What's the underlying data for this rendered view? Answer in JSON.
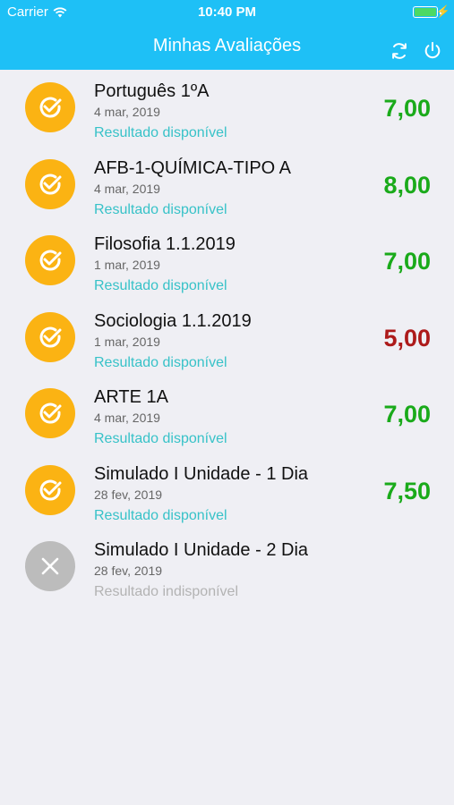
{
  "status_bar": {
    "carrier": "Carrier",
    "time": "10:40 PM",
    "battery_level": 1.0
  },
  "header": {
    "title": "Minhas Avaliações",
    "actions": [
      "refresh-icon",
      "power-icon"
    ]
  },
  "colors": {
    "primary": "#1ec0f6",
    "icon_available": "#fbb313",
    "icon_unavailable": "#bcbcbc",
    "grade_pass": "#1aaa1a",
    "grade_fail": "#ad1a1a",
    "status_available": "#37c2c8",
    "status_unavailable": "#b3b3b3"
  },
  "assessments": [
    {
      "title": "Português 1ºA",
      "date": "4 mar, 2019",
      "status": "Resultado disponível",
      "available": true,
      "grade": "7,00",
      "grade_status": "pass"
    },
    {
      "title": "AFB-1-QUÍMICA-TIPO A",
      "date": "4 mar, 2019",
      "status": "Resultado disponível",
      "available": true,
      "grade": "8,00",
      "grade_status": "pass"
    },
    {
      "title": "Filosofia 1.1.2019",
      "date": "1 mar, 2019",
      "status": "Resultado disponível",
      "available": true,
      "grade": "7,00",
      "grade_status": "pass"
    },
    {
      "title": "Sociologia 1.1.2019",
      "date": "1 mar, 2019",
      "status": "Resultado disponível",
      "available": true,
      "grade": "5,00",
      "grade_status": "fail"
    },
    {
      "title": "ARTE 1A",
      "date": "4 mar, 2019",
      "status": "Resultado disponível",
      "available": true,
      "grade": "7,00",
      "grade_status": "pass"
    },
    {
      "title": "Simulado I Unidade - 1 Dia",
      "date": "28 fev, 2019",
      "status": "Resultado disponível",
      "available": true,
      "grade": "7,50",
      "grade_status": "pass"
    },
    {
      "title": "Simulado I Unidade - 2 Dia",
      "date": "28 fev, 2019",
      "status": "Resultado indisponível",
      "available": false,
      "grade": "",
      "grade_status": "none"
    }
  ]
}
